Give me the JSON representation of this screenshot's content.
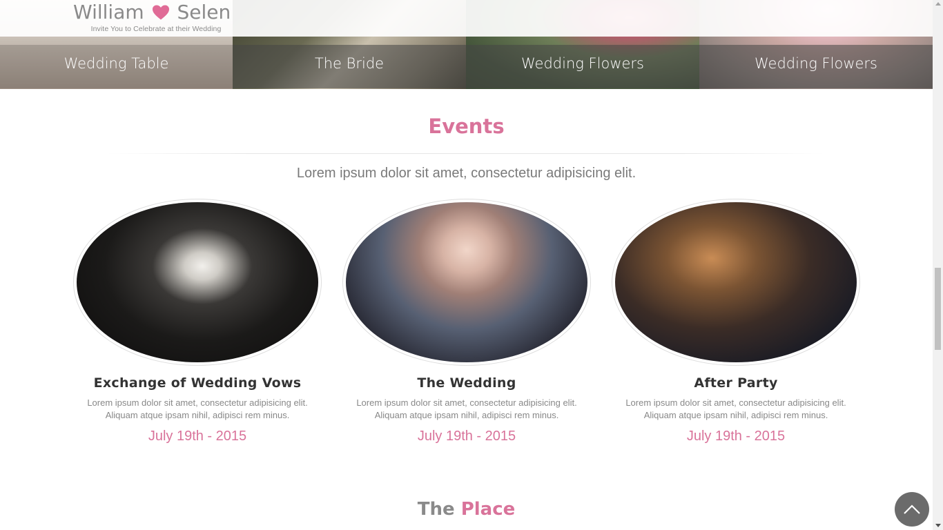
{
  "brand": {
    "name_left": "William",
    "name_right": "Selen",
    "tagline": "Invite You to Celebrate at their Wedding",
    "heart_color": "#e06b96"
  },
  "gallery": [
    {
      "caption": "Wedding Table"
    },
    {
      "caption": "The Bride"
    },
    {
      "caption": "Wedding Flowers"
    },
    {
      "caption": "Wedding Flowers"
    }
  ],
  "events": {
    "title": "Events",
    "subtitle": "Lorem ipsum dolor sit amet, consectetur adipisicing elit.",
    "items": [
      {
        "title": "Exchange of Wedding Vows",
        "desc_line1": "Lorem ipsum dolor sit amet, consectetur adipisicing elit.",
        "desc_line2": "Aliquam atque ipsam nihil, adipisci rem minus.",
        "date": "July 19th - 2015"
      },
      {
        "title": "The Wedding",
        "desc_line1": "Lorem ipsum dolor sit amet, consectetur adipisicing elit.",
        "desc_line2": "Aliquam atque ipsam nihil, adipisci rem minus.",
        "date": "July 19th - 2015"
      },
      {
        "title": "After Party",
        "desc_line1": "Lorem ipsum dolor sit amet, consectetur adipisicing elit.",
        "desc_line2": "Aliquam atque ipsam nihil, adipisci rem minus.",
        "date": "July 19th - 2015"
      }
    ]
  },
  "place": {
    "title_plain": "The",
    "title_accent": "Place"
  },
  "colors": {
    "accent": "#d9739a",
    "text_gray": "#8a8a8a",
    "back_to_top": "#6b6b6b"
  },
  "icons": {
    "heart": "heart-icon",
    "back_to_top": "chevron-up-icon"
  }
}
